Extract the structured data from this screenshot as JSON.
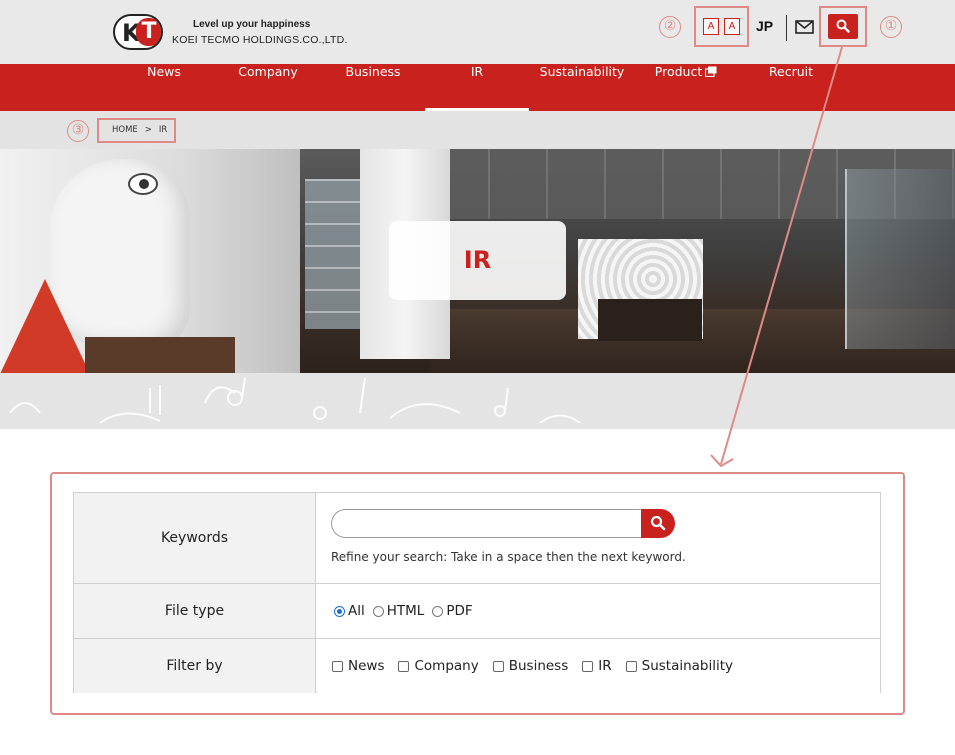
{
  "header": {
    "tagline": "Level up your happiness",
    "company": "KOEI TECMO HOLDINGS.CO.,LTD.",
    "logo_k": "K",
    "logo_t": "T",
    "font_size_a_small": "A",
    "font_size_a_large": "A",
    "language": "JP",
    "callouts": [
      "①",
      "②",
      "③"
    ]
  },
  "nav": {
    "items": [
      {
        "label": "News"
      },
      {
        "label": "Company"
      },
      {
        "label": "Business"
      },
      {
        "label": "IR"
      },
      {
        "label": "Sustainability"
      },
      {
        "label": "Product"
      },
      {
        "label": "Recruit"
      }
    ],
    "active": "IR"
  },
  "breadcrumb": {
    "home": "HOME",
    "separator": ">",
    "current": "IR"
  },
  "hero": {
    "title": "IR"
  },
  "search_form": {
    "keywords_label": "Keywords",
    "keywords_value": "",
    "keywords_hint": "Refine your search: Take in a space then the next keyword.",
    "file_type_label": "File type",
    "file_type_options": [
      {
        "label": "All",
        "selected": true
      },
      {
        "label": "HTML",
        "selected": false
      },
      {
        "label": "PDF",
        "selected": false
      }
    ],
    "filter_label": "Filter by",
    "filter_options": [
      {
        "label": "News",
        "checked": false
      },
      {
        "label": "Company",
        "checked": false
      },
      {
        "label": "Business",
        "checked": false
      },
      {
        "label": "IR",
        "checked": false
      },
      {
        "label": "Sustainability",
        "checked": false
      }
    ]
  },
  "colors": {
    "brand_red": "#c8211e",
    "annotation_pink": "#e08a87",
    "header_bg": "#e9e9e9"
  }
}
